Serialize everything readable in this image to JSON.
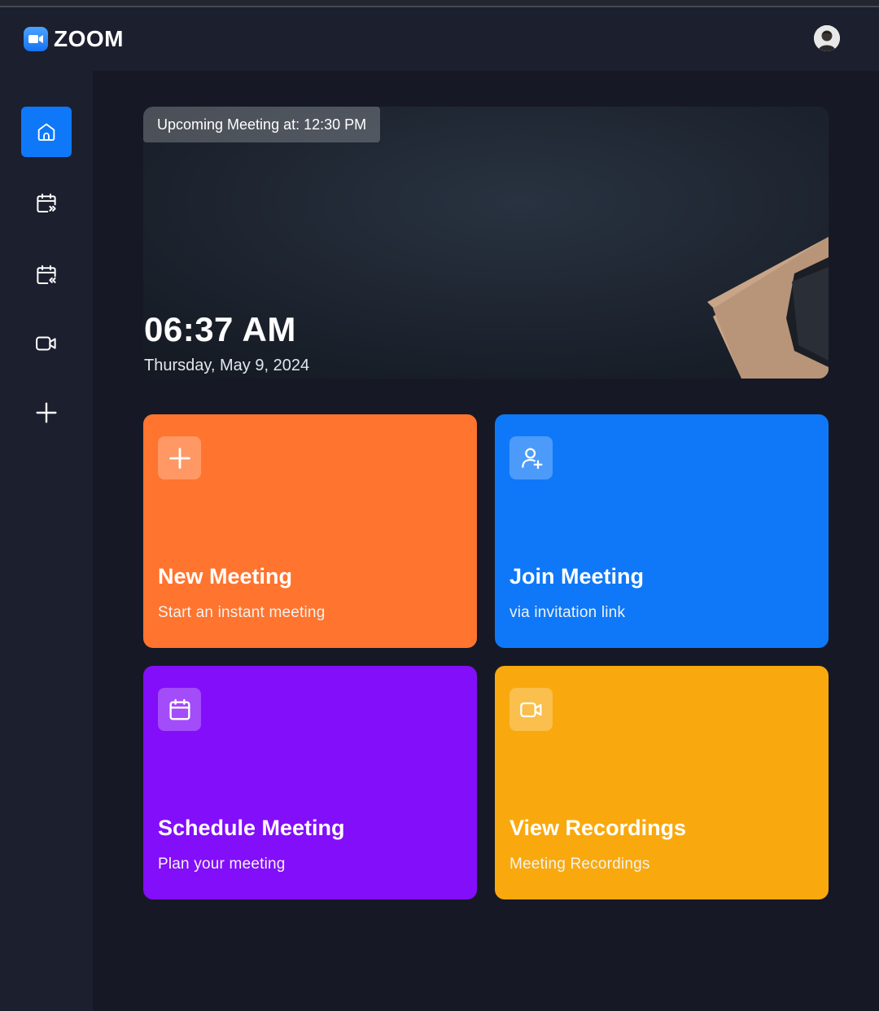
{
  "app": {
    "name": "ZOOM"
  },
  "colors": {
    "accent_blue": "#0E78F9",
    "new_meeting": "#FF742E",
    "join_meeting": "#0E78F9",
    "schedule_meeting": "#830EF9",
    "view_recordings": "#F9A90E",
    "background": "#161925",
    "panel": "#1C1F2E"
  },
  "sidebar": {
    "items": [
      {
        "icon": "home-icon",
        "active": true
      },
      {
        "icon": "calendar-upcoming-icon",
        "active": false
      },
      {
        "icon": "calendar-previous-icon",
        "active": false
      },
      {
        "icon": "video-icon",
        "active": false
      },
      {
        "icon": "plus-icon",
        "active": false
      }
    ]
  },
  "hero": {
    "upcoming": "Upcoming Meeting at: 12:30 PM",
    "time": "06:37 AM",
    "date": "Thursday, May 9, 2024"
  },
  "cards": [
    {
      "title": "New Meeting",
      "subtitle": "Start an instant meeting",
      "icon": "plus-icon"
    },
    {
      "title": "Join Meeting",
      "subtitle": "via invitation link",
      "icon": "add-user-icon"
    },
    {
      "title": "Schedule Meeting",
      "subtitle": "Plan your meeting",
      "icon": "calendar-icon"
    },
    {
      "title": "View Recordings",
      "subtitle": "Meeting Recordings",
      "icon": "video-icon"
    }
  ]
}
